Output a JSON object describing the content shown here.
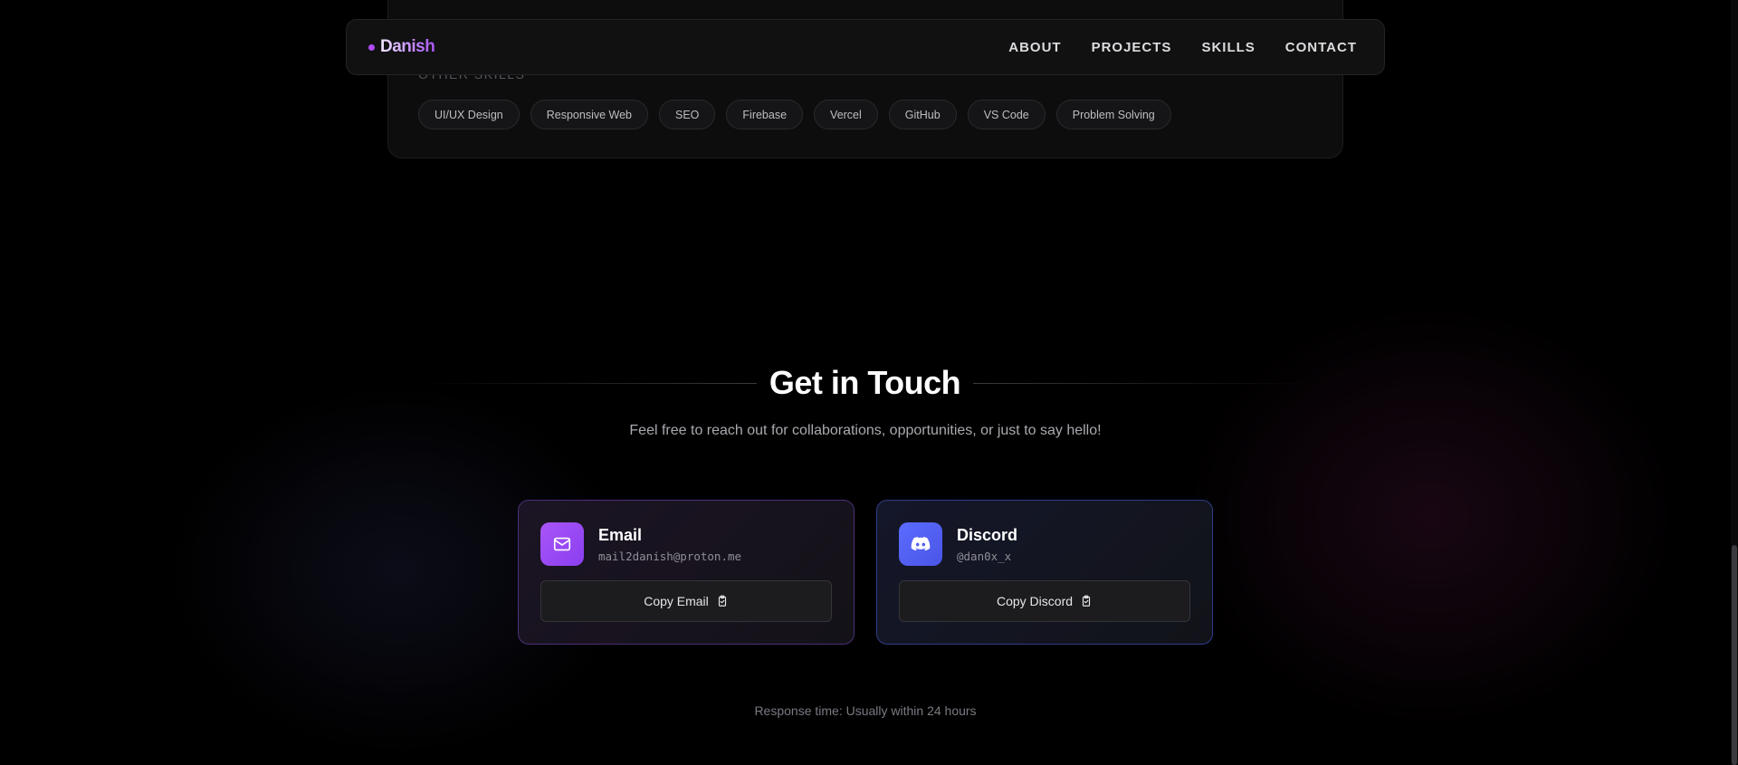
{
  "skills": {
    "other_label": "OTHER SKILLS",
    "chips": [
      "UI/UX Design",
      "Responsive Web",
      "SEO",
      "Firebase",
      "Vercel",
      "GitHub",
      "VS Code",
      "Problem Solving"
    ]
  },
  "navbar": {
    "brand": "Danish",
    "links": [
      "ABOUT",
      "PROJECTS",
      "SKILLS",
      "CONTACT"
    ]
  },
  "contact": {
    "title": "Get in Touch",
    "subtitle": "Feel free to reach out for collaborations, opportunities, or just to say hello!",
    "email": {
      "title": "Email",
      "handle": "mail2danish@proton.me",
      "button": "Copy Email",
      "icon": "mail-icon"
    },
    "discord": {
      "title": "Discord",
      "handle": "@dan0x_x",
      "button": "Copy Discord",
      "icon": "discord-icon"
    },
    "response_time": "Response time: Usually within 24 hours"
  },
  "colors": {
    "accent_purple": "#a855f7",
    "discord_blue": "#5865f2",
    "background": "#000000"
  }
}
